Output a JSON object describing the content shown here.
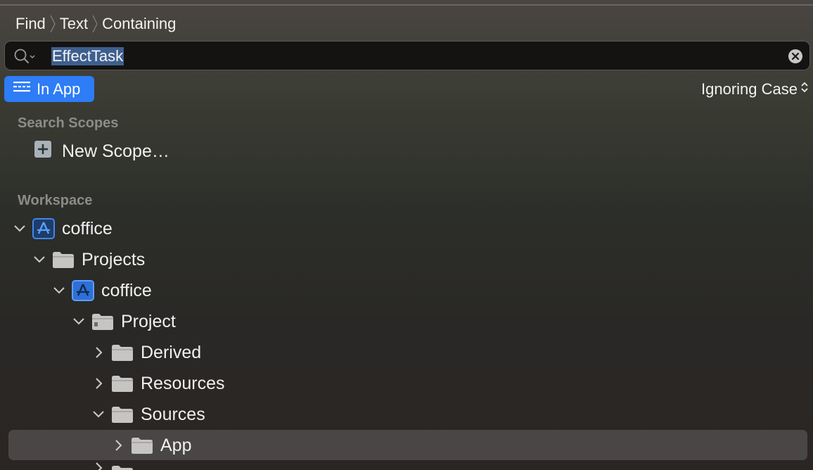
{
  "breadcrumb": {
    "items": [
      "Find",
      "Text",
      "Containing"
    ]
  },
  "search": {
    "value": "EffectTask",
    "icon": "magnifier-icon",
    "clear_icon": "clear-icon"
  },
  "scope_button": {
    "label": "In App",
    "icon": "scope-icon",
    "color": "#2e7cf6"
  },
  "case_option": {
    "label": "Ignoring Case"
  },
  "search_scopes": {
    "header": "Search Scopes",
    "new_scope_label": "New Scope…"
  },
  "workspace": {
    "header": "Workspace",
    "tree": [
      {
        "label": "coffice",
        "icon": "app-project-icon",
        "expanded": true,
        "level": 0
      },
      {
        "label": "Projects",
        "icon": "folder-icon",
        "expanded": true,
        "level": 1
      },
      {
        "label": "coffice",
        "icon": "app-project-icon",
        "expanded": true,
        "level": 2
      },
      {
        "label": "Project",
        "icon": "project-folder-icon",
        "expanded": true,
        "level": 3
      },
      {
        "label": "Derived",
        "icon": "folder-icon",
        "expanded": false,
        "level": 4
      },
      {
        "label": "Resources",
        "icon": "folder-icon",
        "expanded": false,
        "level": 4
      },
      {
        "label": "Sources",
        "icon": "folder-icon",
        "expanded": true,
        "level": 4
      },
      {
        "label": "App",
        "icon": "folder-icon",
        "expanded": false,
        "level": 5,
        "selected": true
      }
    ]
  },
  "colors": {
    "accent": "#2e7cf6",
    "selection_highlight": "#3e5f8e",
    "row_selected": "#4a4645"
  }
}
